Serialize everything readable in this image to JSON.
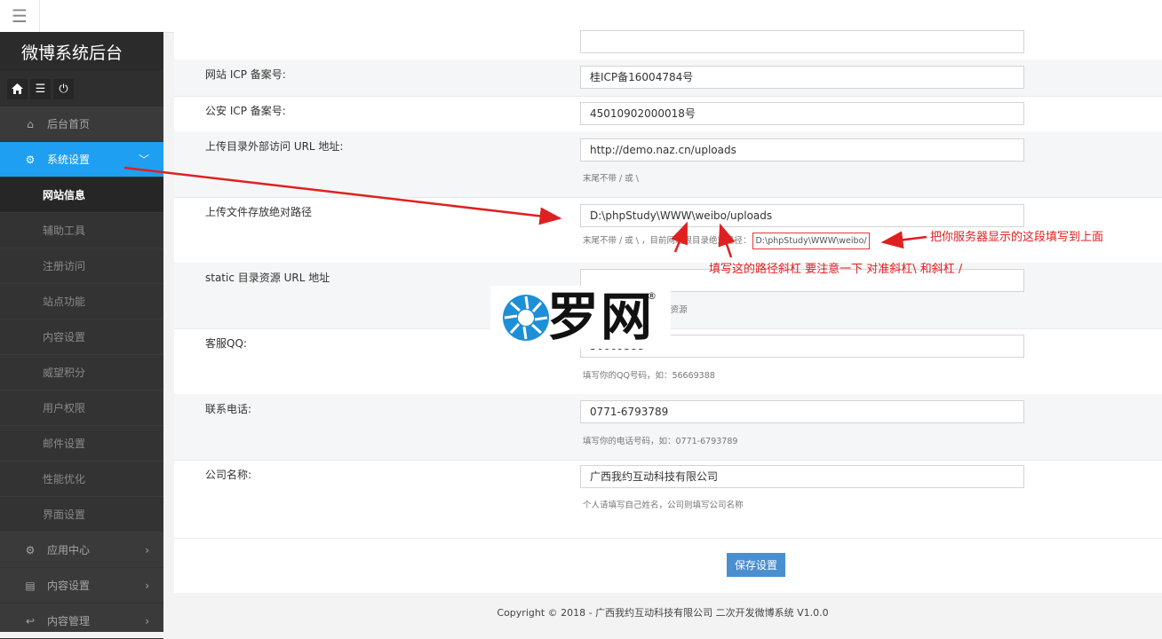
{
  "brand": "微博系统后台",
  "sidebar": {
    "items": [
      {
        "label": "后台首页",
        "icon": "home-icon"
      },
      {
        "label": "系统设置",
        "icon": "gear-icon",
        "expanded": true
      },
      {
        "label": "应用中心",
        "icon": "gear-icon"
      },
      {
        "label": "内容设置",
        "icon": "list-icon"
      },
      {
        "label": "内容管理",
        "icon": "reply-icon"
      }
    ],
    "subitems": [
      "网站信息",
      "辅助工具",
      "注册访问",
      "站点功能",
      "内容设置",
      "威望积分",
      "用户权限",
      "邮件设置",
      "性能优化",
      "界面设置"
    ]
  },
  "form": {
    "icp_label": "网站 ICP 备案号:",
    "icp_value": "桂ICP备16004784号",
    "police_label": "公安 ICP 备案号:",
    "police_value": "45010902000018号",
    "upload_url_label": "上传目录外部访问 URL 地址:",
    "upload_url_value": "http://demo.naz.cn/uploads",
    "upload_url_hint": "末尾不带 / 或 \\",
    "upload_path_label": "上传文件存放绝对路径",
    "upload_path_value": "D:\\phpStudy\\WWW\\weibo/uploads",
    "upload_path_hint": "末尾不带 / 或 \\ ，目前网站根目录绝对路径：",
    "upload_path_current": "D:\\phpStudy\\WWW\\weibo/",
    "static_label": "static 目录资源 URL 地址",
    "static_value": "",
    "static_hint": "使用根目录下的 static 资源",
    "qq_label": "客服QQ:",
    "qq_value": "56669388",
    "qq_hint": "填写你的QQ号码，如：56669388",
    "phone_label": "联系电话:",
    "phone_value": "0771-6793789",
    "phone_hint": "填写你的电话号码，如：0771-6793789",
    "company_label": "公司名称:",
    "company_value": "广西我约互动科技有限公司",
    "company_hint": "个人请填写自己姓名，公司则填写公司名称"
  },
  "save_label": "保存设置",
  "footer": "Copyright © 2018 - 广西我约互动科技有限公司 二次开发微博系统 V1.0.0",
  "annotations": {
    "right": "把你服务器显示的这段填写到上面",
    "below": "填写这的路径斜杠  要注意一下 对准斜杠\\  和斜杠 /"
  },
  "watermark": {
    "text": "罗网",
    "reg": "®"
  },
  "colors": {
    "accent": "#1e9ff2",
    "sidebar": "#3a3a3a",
    "button": "#4a8fd0",
    "annotation": "#e02020"
  }
}
